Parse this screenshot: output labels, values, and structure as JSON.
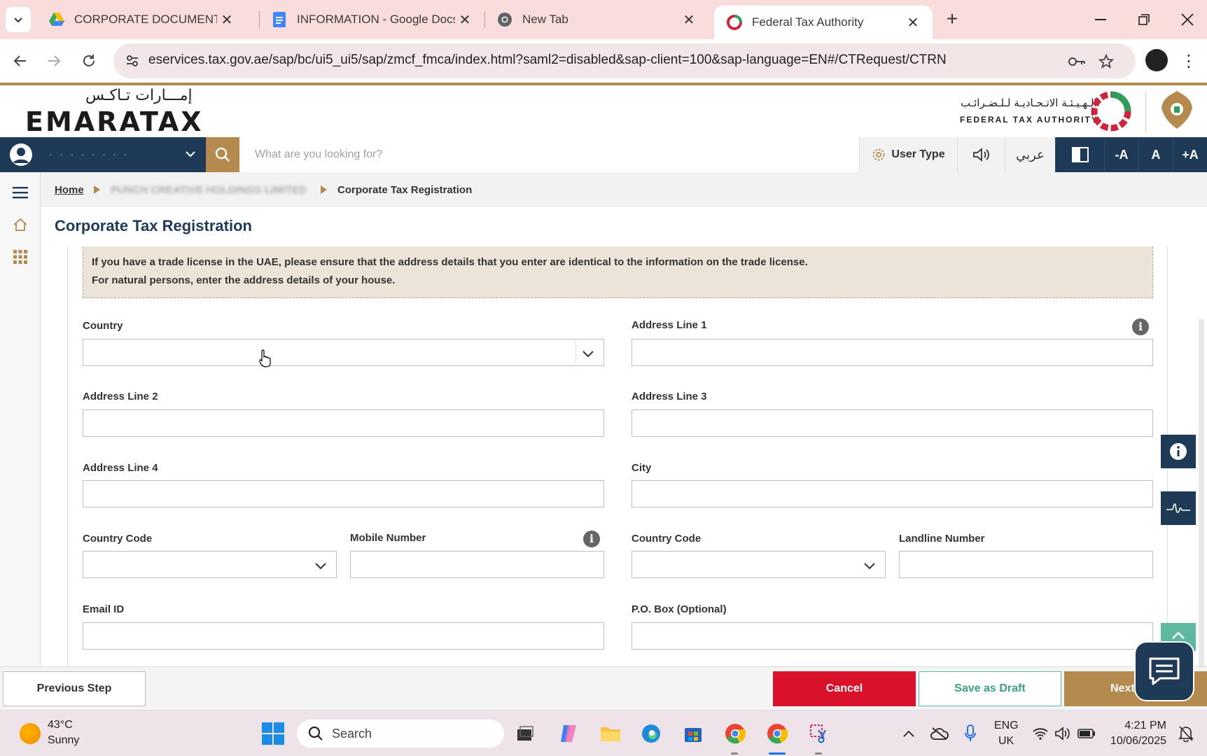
{
  "browser": {
    "tabs": [
      {
        "title": "CORPORATE DOCUMENT - Acc",
        "icon": "google-drive-icon"
      },
      {
        "title": "INFORMATION - Google Docs",
        "icon": "google-docs-icon"
      },
      {
        "title": "New Tab",
        "icon": "chrome-icon"
      },
      {
        "title": "Federal Tax Authority",
        "icon": "fta-icon",
        "active": true
      }
    ],
    "url": "eservices.tax.gov.ae/sap/bc/ui5_ui5/sap/zmcf_fmca/index.html?saml2=disabled&sap-client=100&sap-language=EN#/CTRequest/CTRN"
  },
  "site": {
    "logo_ar": "إمـــارات تـاكـس",
    "logo_en": "EMARATAX",
    "fta_ar": "الـهـيـئـة الاتـحـاديـة لـلـضـرائـب",
    "fta_en": "FEDERAL TAX AUTHORITY"
  },
  "nav": {
    "user_name": "· · · · · · · ·",
    "search_placeholder": "What are you looking for?",
    "user_type": "User Type",
    "arabic": "عربي",
    "font_minus": "-A",
    "font_normal": "A",
    "font_plus": "+A"
  },
  "breadcrumb": {
    "home": "Home",
    "company": "PUNCH CREATIVE HOLDINGS LIMITED",
    "current": "Corporate Tax Registration"
  },
  "page_title": "Corporate Tax Registration",
  "notice": {
    "line1": "If you have a trade license in the UAE, please ensure that the address details that you enter are identical to the information on the trade license.",
    "line2": "For natural persons, enter the address details of your house."
  },
  "form": {
    "country": {
      "label": "Country",
      "value": ""
    },
    "address1": {
      "label": "Address Line 1",
      "value": ""
    },
    "address2": {
      "label": "Address Line 2",
      "value": ""
    },
    "address3": {
      "label": "Address Line 3",
      "value": ""
    },
    "address4": {
      "label": "Address Line 4",
      "value": ""
    },
    "city": {
      "label": "City",
      "value": ""
    },
    "mobile_cc": {
      "label": "Country Code",
      "value": ""
    },
    "mobile": {
      "label": "Mobile Number",
      "value": ""
    },
    "landline_cc": {
      "label": "Country Code",
      "value": ""
    },
    "landline": {
      "label": "Landline Number",
      "value": ""
    },
    "email": {
      "label": "Email ID",
      "value": ""
    },
    "pobox": {
      "label": "P.O. Box (Optional)",
      "value": ""
    }
  },
  "footer": {
    "previous": "Previous Step",
    "cancel": "Cancel",
    "save_draft": "Save as Draft",
    "next": "Next"
  },
  "taskbar": {
    "temp": "43°C",
    "condition": "Sunny",
    "search": "Search",
    "lang1": "ENG",
    "lang2": "UK",
    "time": "4:21 PM",
    "date": "10/06/2025"
  },
  "colors": {
    "brand_navy": "#1e3a57",
    "brand_gold": "#b58a4e",
    "cancel_red": "#d9112a",
    "draft_green": "#5fb8a0"
  }
}
